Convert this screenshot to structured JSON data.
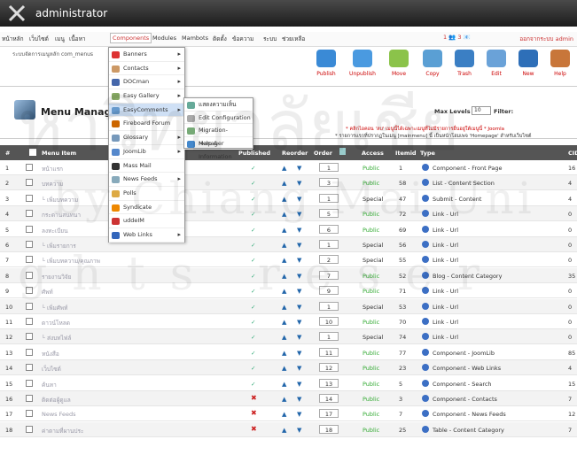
{
  "header": {
    "title": "administrator"
  },
  "menubar": {
    "items": [
      "หน้าหลัก",
      "เว็บไซต์",
      "เมนู",
      "เนื้อหา",
      "Components",
      "Modules",
      "Mambots",
      "ติดตั้ง",
      "ข้อความ",
      "ระบบ",
      "ช่วยเหลือ"
    ],
    "session": "1 👥 3 📧",
    "right": "ออกจากระบบ admin"
  },
  "sub": {
    "text": "ระบบจัดการเมนูหลัก com_menus"
  },
  "toolbar": [
    "Publish",
    "Unpublish",
    "Move",
    "Copy",
    "Trash",
    "Edit",
    "New",
    "Help"
  ],
  "page": {
    "title": "Menu Manager",
    "max_levels_label": "Max Levels",
    "max_levels": "10",
    "filter_label": "Filter:",
    "note1": "* คลิกไอคอน 'ลบ' เมนูนี้ได้เฉพาะเมนูที่ไม่มีรายการอื่นอยู่ใต้เมนูนี้ * Joomla",
    "note2": "* รายการแรกที่ปรากฏในเมนู [mainmenu] นี้ เป็นหน้าโฮมเพจ 'Homepage' สำหรับเว็บไซต์"
  },
  "table": {
    "headers": [
      "#",
      "Menu Item",
      "Published",
      "Reorder",
      "Order",
      "Access",
      "Itemid",
      "Type",
      "CID"
    ],
    "rows": [
      {
        "n": "1",
        "name": "หน้าแรก",
        "pub": true,
        "order": "1",
        "access": "Public",
        "itemid": "1",
        "type": "Component - Front Page",
        "cid": "16"
      },
      {
        "n": "2",
        "name": "บทความ",
        "pub": true,
        "order": "3",
        "access": "Public",
        "itemid": "58",
        "type": "List - Content Section",
        "cid": "4"
      },
      {
        "n": "3",
        "name": "└ เพิ่มบทความ",
        "pub": true,
        "order": "1",
        "access": "Special",
        "itemid": "47",
        "type": "Submit - Content",
        "cid": "4"
      },
      {
        "n": "4",
        "name": "กระดานสนทนา",
        "pub": true,
        "order": "5",
        "access": "Public",
        "itemid": "72",
        "type": "Link - Url",
        "cid": "0"
      },
      {
        "n": "5",
        "name": "ลงทะเบียน",
        "pub": true,
        "order": "6",
        "access": "Public",
        "itemid": "69",
        "type": "Link - Url",
        "cid": "0"
      },
      {
        "n": "6",
        "name": "└ เพิ่มรายการ",
        "pub": true,
        "order": "1",
        "access": "Special",
        "itemid": "56",
        "type": "Link - Url",
        "cid": "0"
      },
      {
        "n": "7",
        "name": "└ เพิ่มบทความ/คุณภาพ",
        "pub": true,
        "order": "2",
        "access": "Special",
        "itemid": "55",
        "type": "Link - Url",
        "cid": "0"
      },
      {
        "n": "8",
        "name": "รายงานวิจัย",
        "pub": true,
        "order": "7",
        "access": "Public",
        "itemid": "52",
        "type": "Blog - Content Category",
        "cid": "35"
      },
      {
        "n": "9",
        "name": "ศัพท์",
        "pub": true,
        "order": "9",
        "access": "Public",
        "itemid": "71",
        "type": "Link - Url",
        "cid": "0"
      },
      {
        "n": "10",
        "name": "└ เพิ่มศัพท์",
        "pub": true,
        "order": "1",
        "access": "Special",
        "itemid": "53",
        "type": "Link - Url",
        "cid": "0"
      },
      {
        "n": "11",
        "name": "ดาวน์โหลด",
        "pub": true,
        "order": "10",
        "access": "Public",
        "itemid": "70",
        "type": "Link - Url",
        "cid": "0"
      },
      {
        "n": "12",
        "name": "└ ส่งบทไฟล์",
        "pub": true,
        "order": "1",
        "access": "Special",
        "itemid": "74",
        "type": "Link - Url",
        "cid": "0"
      },
      {
        "n": "13",
        "name": "หนังสือ",
        "pub": true,
        "order": "11",
        "access": "Public",
        "itemid": "77",
        "type": "Component - JoomLib",
        "cid": "85"
      },
      {
        "n": "14",
        "name": "เว็บไซต์",
        "pub": true,
        "order": "12",
        "access": "Public",
        "itemid": "23",
        "type": "Component - Web Links",
        "cid": "4"
      },
      {
        "n": "15",
        "name": "ค้นหา",
        "pub": true,
        "order": "13",
        "access": "Public",
        "itemid": "5",
        "type": "Component - Search",
        "cid": "15"
      },
      {
        "n": "16",
        "name": "ติดต่อผู้ดูแล",
        "pub": false,
        "order": "14",
        "access": "Public",
        "itemid": "3",
        "type": "Component - Contacts",
        "cid": "7"
      },
      {
        "n": "17",
        "name": "News Feeds",
        "pub": false,
        "order": "17",
        "access": "Public",
        "itemid": "7",
        "type": "Component - News Feeds",
        "cid": "12"
      },
      {
        "n": "18",
        "name": "ค่าตามที่ผานประ",
        "pub": false,
        "order": "18",
        "access": "Public",
        "itemid": "25",
        "type": "Table - Content Category",
        "cid": "7"
      }
    ]
  },
  "components_menu": [
    "Banners",
    "Contacts",
    "DOCman",
    "Easy Gallery",
    "EasyComments",
    "Fireboard Forum",
    "Glossary",
    "JoomLib",
    "Mass Mail",
    "News Feeds",
    "Polls",
    "Syndicate",
    "uddeIM",
    "Web Links"
  ],
  "easycomments_menu": [
    "แสดงความเห็น",
    "Edit Configuration",
    "Migration-Manager",
    "Help & Information"
  ],
  "watermark": {
    "line1": "หาวิทยาลัยเชีย",
    "line2": "by Chiang Mai Uni",
    "line3": "ghts reser"
  }
}
